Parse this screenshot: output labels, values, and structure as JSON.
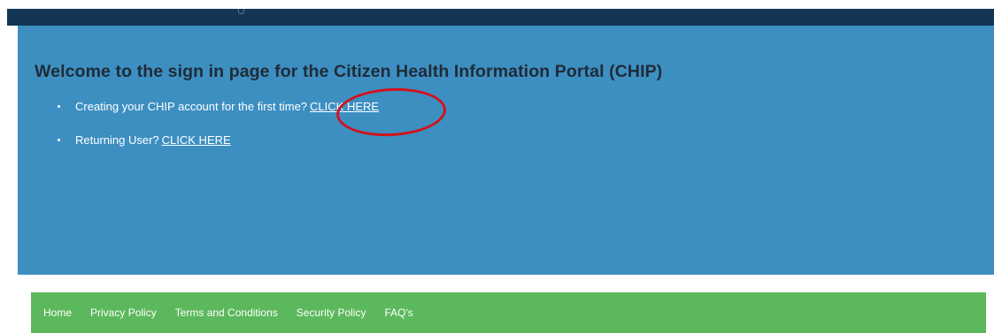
{
  "hero": {
    "title": "Welcome to the sign in page for the Citizen Health Information Portal (CHIP)",
    "options": [
      {
        "text": "Creating your CHIP account for the first time?",
        "link": "CLICK HERE"
      },
      {
        "text": "Returning User?",
        "link": "CLICK HERE"
      }
    ]
  },
  "annotation": {
    "color": "#d3121c"
  },
  "footer": {
    "links": [
      "Home",
      "Privacy Policy",
      "Terms and Conditions",
      "Security Policy",
      "FAQ's"
    ]
  },
  "colors": {
    "header_bar": "#123654",
    "hero_bg": "#3d8fc2",
    "footer_bg": "#5cb85c"
  }
}
